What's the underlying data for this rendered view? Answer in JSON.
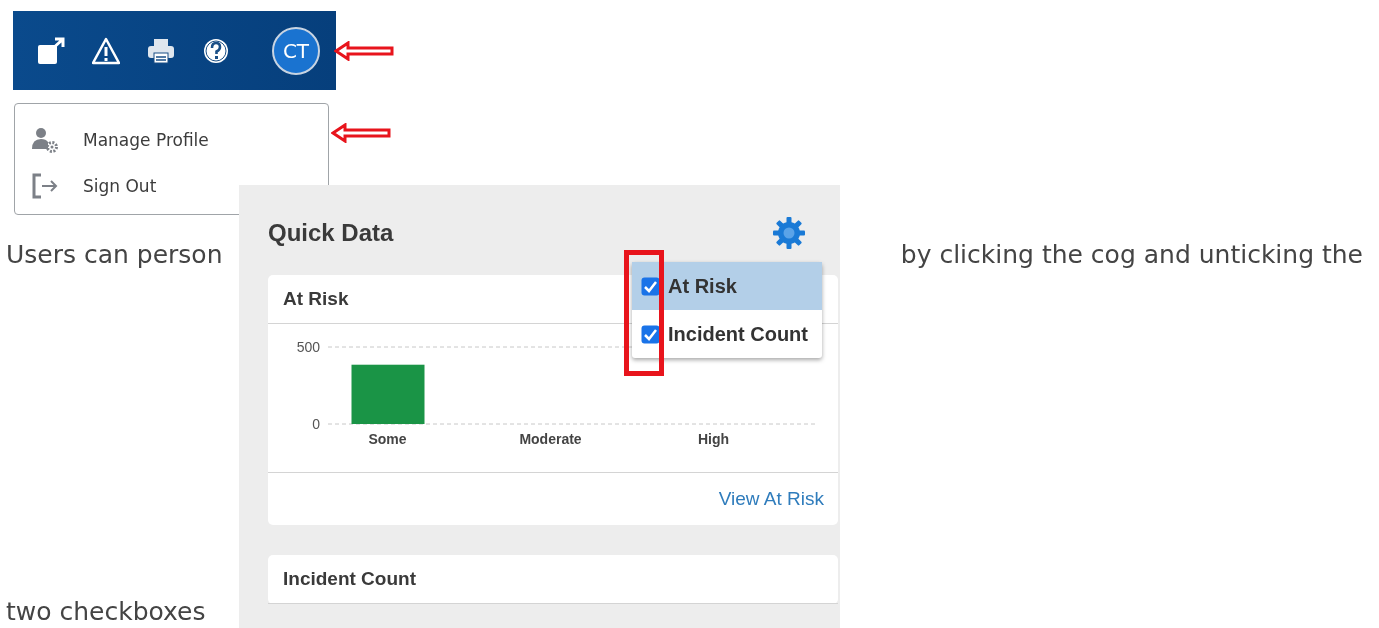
{
  "header": {
    "avatar": {
      "initials": "CT"
    }
  },
  "profile_menu": {
    "items": [
      {
        "kind": "profile",
        "label": "Manage Profile"
      },
      {
        "kind": "signout",
        "label": "Sign Out"
      }
    ]
  },
  "paragraph": {
    "line_1_start": "Users can person",
    "line_1_end": "by clicking the cog and unticking the",
    "line_2": "two checkboxes"
  },
  "quick_data": {
    "title": "Quick Data",
    "options": [
      {
        "label": "At Risk",
        "checked": true,
        "selected": true
      },
      {
        "label": "Incident Count",
        "checked": true,
        "selected": false
      }
    ],
    "cards": [
      {
        "title": "At Risk",
        "link": "View At Risk",
        "chart_data": {
          "type": "bar",
          "categories": [
            "Some",
            "Moderate",
            "High"
          ],
          "series": [
            {
              "color": "#1a9446",
              "values": [
                385,
                0,
                0
              ]
            }
          ],
          "ylim": [
            0,
            500
          ],
          "yticks": [
            0,
            500
          ]
        }
      },
      {
        "title": "Incident Count"
      }
    ]
  }
}
